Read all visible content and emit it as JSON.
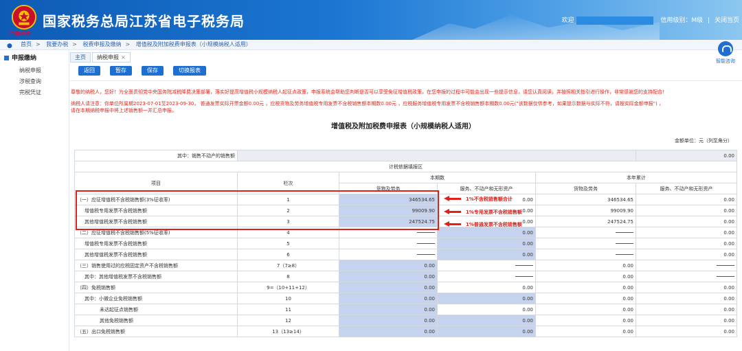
{
  "header": {
    "title": "国家税务总局江苏省电子税务局",
    "logo_text": "中国税务",
    "welcome": "欢迎",
    "credit": "信用级别：M级",
    "close": "关闭当页",
    "separator": "|"
  },
  "breadcrumb": [
    "首页",
    "我要办税",
    "税费申报及缴纳",
    "增值税及附加税费申报表（小规模纳税人适用）"
  ],
  "breadcrumb_sep": ">",
  "help": {
    "label": "智能咨询"
  },
  "sidebar": {
    "head": "申报缴纳",
    "items": [
      "纳税申报",
      "涉税查询",
      "完税凭证"
    ]
  },
  "tabs": [
    {
      "label": "主页"
    },
    {
      "label": "纳税申报",
      "close": "×"
    }
  ],
  "toolbar": {
    "back": "返回",
    "stash": "暂存",
    "save": "保存",
    "switch": "切换报表"
  },
  "notice": {
    "line1": "尊敬的纳税人，您好！为全面贯彻党中央国务院减税降费决策部署，落实好提高增值税小规模纳税人起征点政策，申报系统会帮助您判断是否可以享受免征增值税政策，在您申报的过程中可能会出现一些提示信息，请您认真阅读，并按照相关指引进行操作，非常感谢您的支持配合！",
    "line2": "纳税人请注意：你单位所属期2023-07-01至2023-09-30， 普通发票实际开票金额0.00元 ，应税货物及劳务增值税专用发票不含税销售额本期数0.00元 ，应税服务增值税专用发票不含税销售额本期数0.00元(\"该数据仅供参考，如果提示数据与实际不符，请按实际金额申报\") ，",
    "line3": "请在本期纳税申报中将上述销售额一并汇总申报。"
  },
  "form": {
    "title": "增值税及附加税费申报表（小规模纳税人适用）",
    "unit": "金额单位：元（列至角分）",
    "top_row_label": "其中：销售不动产的销售额",
    "top_row_value": "0.00",
    "section": "计税依据填报区",
    "headers": {
      "item": "项目",
      "col": "栏次",
      "current": "本期数",
      "ytd": "本年累计",
      "goods": "货物及劳务",
      "services": "服务、不动产和无形资产"
    },
    "rows": [
      {
        "label": "（一）应征增值税不含税销售额(3%征收率)",
        "col": "1",
        "g": "346534.65",
        "s": "0.00",
        "yg": "346534.65",
        "ys": "0.00",
        "indent": 0
      },
      {
        "label": "增值税专用发票不含税销售额",
        "col": "2",
        "g": "99009.90",
        "s": "0.00",
        "yg": "99009.90",
        "ys": "0.00",
        "indent": 1
      },
      {
        "label": "其他增值税发票不含税销售额",
        "col": "3",
        "g": "247524.75",
        "s": "0.00",
        "yg": "247524.75",
        "ys": "0.00",
        "indent": 1
      },
      {
        "label": "（二）应征增值税不含税销售额(5%征收率)",
        "col": "4",
        "g": "—",
        "s": "0.00",
        "yg": "—",
        "ys": "0.00",
        "indent": 0
      },
      {
        "label": "增值税专用发票不含税销售额",
        "col": "5",
        "g": "—",
        "s": "0.00",
        "yg": "—",
        "ys": "0.00",
        "indent": 1
      },
      {
        "label": "其他增值税发票不含税销售额",
        "col": "6",
        "g": "—",
        "s": "0.00",
        "yg": "—",
        "ys": "0.00",
        "indent": 1
      },
      {
        "label": "（三）销售使用过的应税固定资产不含税销售额",
        "col": "7（7≥8）",
        "g": "0.00",
        "s": "—",
        "yg": "0.00",
        "ys": "—",
        "indent": 0
      },
      {
        "label": "其中：其他增值税发票不含税销售额",
        "col": "8",
        "g": "0.00",
        "s": "—",
        "yg": "0.00",
        "ys": "—",
        "indent": 1
      },
      {
        "label": "（四）免税销售额",
        "col": "9=（10+11+12）",
        "g": "0.00",
        "s": "0.00",
        "yg": "0.00",
        "ys": "0.00",
        "indent": 0
      },
      {
        "label": "其中：小微企业免税销售额",
        "col": "10",
        "g": "0.00",
        "s": "0.00",
        "yg": "0.00",
        "ys": "0.00",
        "indent": 1
      },
      {
        "label": "未达起征点销售额",
        "col": "11",
        "g": "0.00",
        "s": "0.00",
        "yg": "0.00",
        "ys": "0.00",
        "indent": 2
      },
      {
        "label": "其他免税销售额",
        "col": "12",
        "g": "0.00",
        "s": "0.00",
        "yg": "0.00",
        "ys": "0.00",
        "indent": 2
      },
      {
        "label": "（五）出口免税销售额",
        "col": "13（13≥14）",
        "g": "0.00",
        "s": "0.00",
        "yg": "0.00",
        "ys": "0.00",
        "indent": 0
      }
    ]
  },
  "annotations": [
    "1%不含税销售额合计",
    "1%专用发票不含税销售额",
    "1%普通发票不含税销售额"
  ],
  "colors": {
    "brand_blue": "#1f6fd1",
    "highlight_red": "#e0201a",
    "input_cell": "#c6d3ee"
  }
}
